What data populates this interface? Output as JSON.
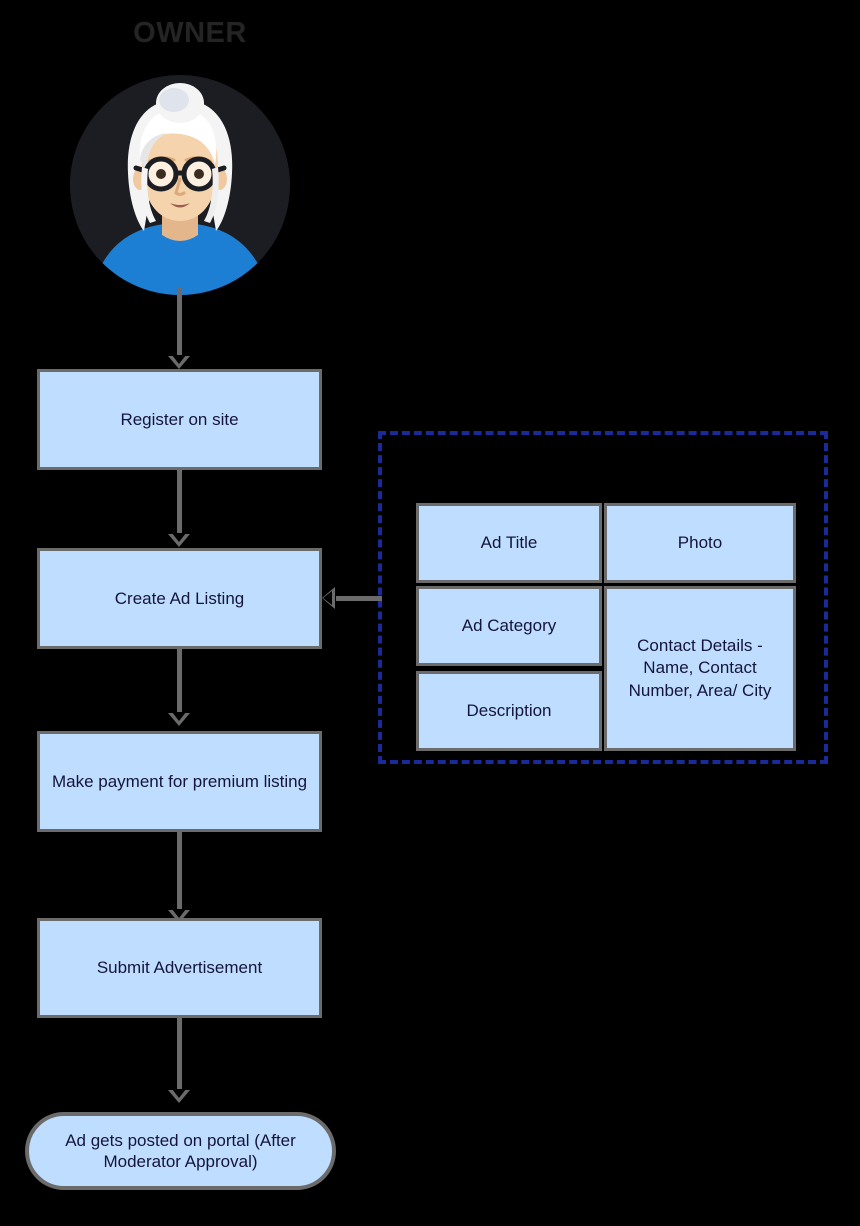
{
  "diagram": {
    "title": "Owner advertisement posting flow",
    "background_color": "#000000",
    "accent_box_fill": "#bfdeff",
    "accent_box_border": "#6b6b6b",
    "dashed_group_border": "#1b2a99",
    "connector_color": "#6b6b6b"
  },
  "actor": {
    "label": "OWNER",
    "avatar_name": "elderly-woman-avatar",
    "avatar_colors": {
      "circle_background": "#1c1d23",
      "hair": "#f2f2f2",
      "skin": "#f0c9a0",
      "glasses": "#1c1d23",
      "shirt": "#1d7fd4"
    }
  },
  "flow": {
    "steps": [
      {
        "id": "register",
        "label": "Register on site",
        "shape": "rectangle"
      },
      {
        "id": "create-ad",
        "label": "Create Ad Listing",
        "shape": "rectangle"
      },
      {
        "id": "payment",
        "label": "Make payment for premium listing",
        "shape": "rectangle"
      },
      {
        "id": "submit",
        "label": "Submit Advertisement",
        "shape": "rectangle"
      },
      {
        "id": "posted",
        "label": "Ad gets posted on portal (After Moderator Approval)",
        "shape": "terminal"
      }
    ]
  },
  "ad_details_group": {
    "border_style": "dashed",
    "cells": [
      {
        "id": "ad-title",
        "label": "Ad Title"
      },
      {
        "id": "photo",
        "label": "Photo"
      },
      {
        "id": "ad-category",
        "label": "Ad Category"
      },
      {
        "id": "contact-details",
        "label": "Contact Details - Name, Contact Number, Area/ City"
      },
      {
        "id": "description",
        "label": "Description"
      }
    ]
  },
  "connectors": [
    {
      "from": "owner-avatar",
      "to": "register",
      "direction": "down"
    },
    {
      "from": "register",
      "to": "create-ad",
      "direction": "down"
    },
    {
      "from": "create-ad",
      "to": "payment",
      "direction": "down"
    },
    {
      "from": "payment",
      "to": "submit",
      "direction": "down"
    },
    {
      "from": "submit",
      "to": "posted",
      "direction": "down"
    },
    {
      "from": "ad-details-group",
      "to": "create-ad",
      "direction": "left"
    }
  ]
}
